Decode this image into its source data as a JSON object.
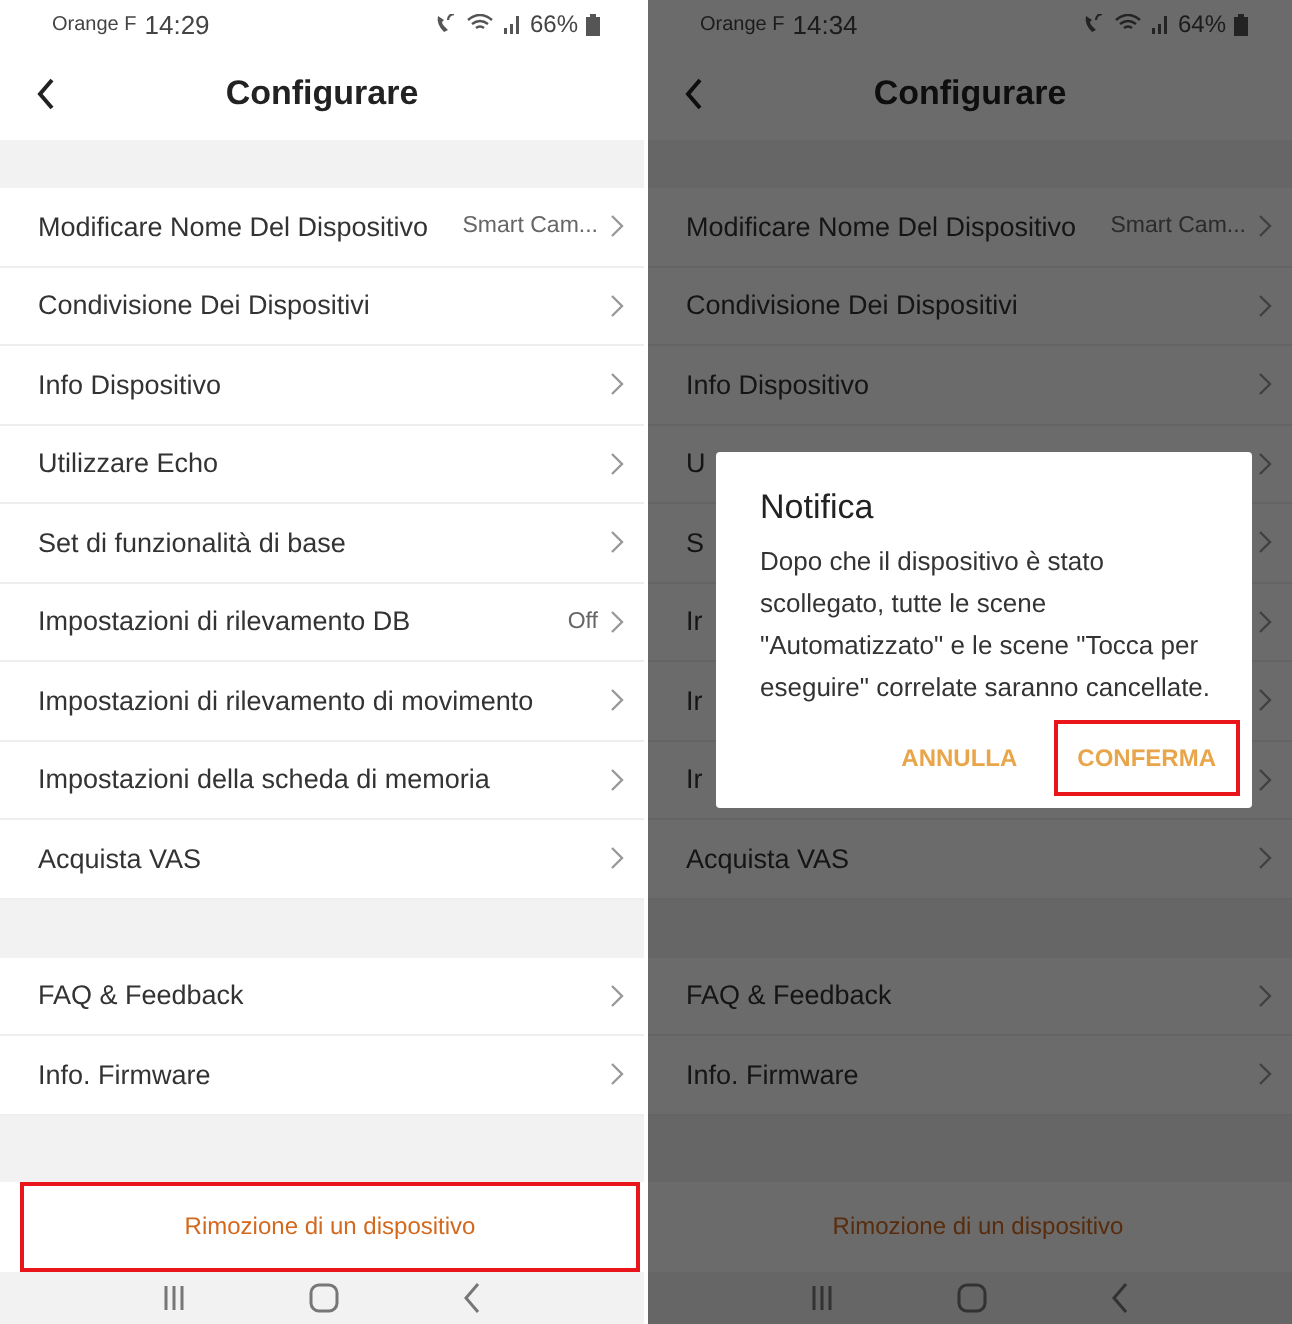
{
  "phones": [
    {
      "status": {
        "carrier": "Orange F",
        "time": "14:29",
        "battery": "66%"
      },
      "title": "Configurare",
      "sections": [
        [
          {
            "label": "Modificare Nome Del Dispositivo",
            "value": "Smart Cam..."
          },
          {
            "label": "Condivisione Dei Dispositivi"
          },
          {
            "label": "Info Dispositivo"
          },
          {
            "label": "Utilizzare Echo"
          },
          {
            "label": "Set di funzionalità di base"
          },
          {
            "label": "Impostazioni di rilevamento DB",
            "value": "Off"
          },
          {
            "label": "Impostazioni di rilevamento di movimento"
          },
          {
            "label": "Impostazioni della scheda di memoria"
          },
          {
            "label": "Acquista VAS"
          }
        ],
        [
          {
            "label": "FAQ & Feedback"
          },
          {
            "label": "Info. Firmware"
          }
        ]
      ],
      "remove_button": {
        "label": "Rimozione di un dispositivo",
        "highlighted": true
      }
    },
    {
      "status": {
        "carrier": "Orange F",
        "time": "14:34",
        "battery": "64%"
      },
      "title": "Configurare",
      "sections": [
        [
          {
            "label": "Modificare Nome Del Dispositivo",
            "value": "Smart Cam..."
          },
          {
            "label": "Condivisione Dei Dispositivi"
          },
          {
            "label": "Info Dispositivo"
          },
          {
            "label": "U"
          },
          {
            "label": "S"
          },
          {
            "label": "Ir"
          },
          {
            "label": "Ir"
          },
          {
            "label": "Ir"
          },
          {
            "label": "Acquista VAS"
          }
        ],
        [
          {
            "label": "FAQ & Feedback"
          },
          {
            "label": "Info. Firmware"
          }
        ]
      ],
      "remove_button": {
        "label": "Rimozione di un dispositivo",
        "highlighted": false
      },
      "dialog": {
        "title": "Notifica",
        "message": "Dopo che il dispositivo è stato scollegato, tutte le scene \"Automatizzato\" e le scene \"Tocca per eseguire\" correlate saranno cancellate.",
        "buttons": [
          {
            "label": "ANNULLA",
            "highlighted": false
          },
          {
            "label": "CONFERMA",
            "highlighted": true
          }
        ]
      }
    }
  ]
}
